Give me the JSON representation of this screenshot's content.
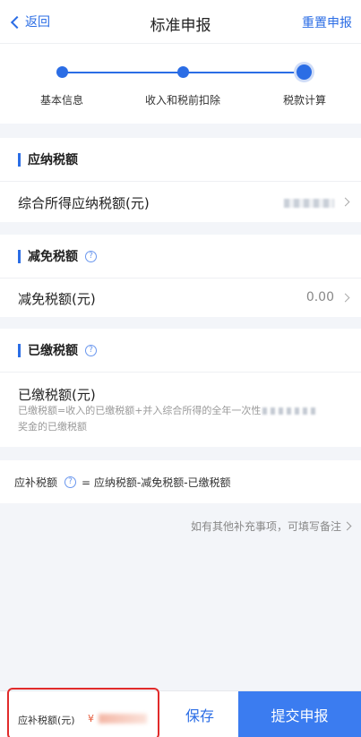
{
  "nav": {
    "back_label": "返回",
    "title": "标准申报",
    "right_action": "重置申报"
  },
  "steps": [
    {
      "label": "基本信息"
    },
    {
      "label": "收入和税前扣除"
    },
    {
      "label": "税款计算"
    }
  ],
  "sections": {
    "payable": {
      "header": "应纳税额",
      "row_title": "综合所得应纳税额(元)"
    },
    "reduction": {
      "header": "减免税额",
      "row_title": "减免税额(元)",
      "row_value": "0.00"
    },
    "paid": {
      "header": "已缴税额",
      "row_title": "已缴税额(元)",
      "desc_line1": "已缴税额=收入的已缴税额+并入综合所得的全年一次性",
      "desc_line2": "奖金的已缴税额"
    }
  },
  "formula": {
    "label": "应补税额",
    "expression": "= 应纳税额-减免税额-已缴税额"
  },
  "remark_link": "如有其他补充事项，可填写备注",
  "bottom": {
    "due_label": "应补税额(元)",
    "currency": "¥",
    "save_label": "保存",
    "submit_label": "提交申报"
  },
  "icons": {
    "back": "chevron-left-icon",
    "help": "help-circle-icon",
    "arrow": "chevron-right-icon"
  },
  "colors": {
    "accent": "#2b6de5",
    "submit_bg": "#3b7cf0",
    "highlight_border": "#e12b2b"
  }
}
